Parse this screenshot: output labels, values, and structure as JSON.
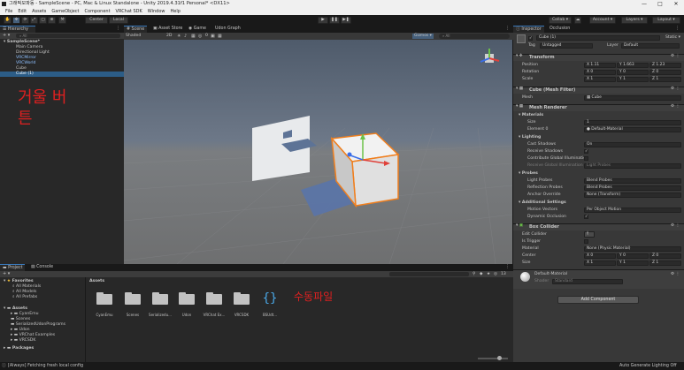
{
  "window": {
    "title": "그래픽모파동 - SampleScene - PC, Mac & Linux Standalone - Unity 2019.4.31f1 Personal* <DX11>",
    "controls": [
      "—",
      "□",
      "✕"
    ]
  },
  "menu": [
    "File",
    "Edit",
    "Assets",
    "GameObject",
    "Component",
    "VRChat SDK",
    "Window",
    "Help"
  ],
  "toolbar": {
    "pivot_label": "Center",
    "space_label": "Local",
    "play_icons": [
      "▶",
      "❚❚",
      "▶❚"
    ],
    "collab_label": "Collab ▾",
    "account_label": "Account ▾",
    "layers_label": "Layers ▾",
    "layout_label": "Layout ▾"
  },
  "hierarchy": {
    "tab": "Hierarchy",
    "search_placeholder": "All",
    "items": [
      {
        "label": "SampleScene*",
        "indent": 0,
        "color": "normal",
        "bold": true
      },
      {
        "label": "Main Camera",
        "indent": 1,
        "color": "normal"
      },
      {
        "label": "Directional Light",
        "indent": 1,
        "color": "normal"
      },
      {
        "label": "VRCMirror",
        "indent": 1,
        "color": "blue"
      },
      {
        "label": "VRCWorld",
        "indent": 1,
        "color": "blue"
      },
      {
        "label": "Cube",
        "indent": 1,
        "color": "normal"
      },
      {
        "label": "Cube (1)",
        "indent": 1,
        "color": "selected"
      }
    ],
    "annotation": "거울 버튼"
  },
  "scene_tabs": [
    "Scene",
    "Asset Store",
    "Game",
    "Udon Graph"
  ],
  "scene_toolbar": {
    "shading": "Shaded",
    "mode_2d": "2D",
    "gizmos": "Gizmos ▾",
    "search_placeholder": "All",
    "hidden_count": "0"
  },
  "project": {
    "tabs": [
      "Project",
      "Console"
    ],
    "favorites_title": "Favorites",
    "favorites": [
      "All Materials",
      "All Models",
      "All Prefabs"
    ],
    "assets_title": "Assets",
    "tree": [
      "CyanEmu",
      "Scenes",
      "SerializedUdonPrograms",
      "Udon",
      "VRChat Examples",
      "VRCSDK"
    ],
    "packages": "Packages",
    "breadcrumb": "Assets",
    "asset_items": [
      "CyanEmu",
      "Scenes",
      "Serializedu...",
      "Udon",
      "VRChat Ex...",
      "VRCSDK",
      "BSUdt..."
    ],
    "annotation": "수동파일",
    "hidden_count": "13"
  },
  "inspector": {
    "tabs": [
      "Inspector",
      "Occlusion"
    ],
    "object_name": "Cube (1)",
    "static_label": "Static ▾",
    "tag_label": "Tag",
    "tag_value": "Untagged",
    "layer_label": "Layer",
    "layer_value": "Default",
    "transform": {
      "title": "Transform",
      "rows": [
        {
          "label": "Position",
          "x": "1.11",
          "y": "1.663",
          "z": "1.23"
        },
        {
          "label": "Rotation",
          "x": "0",
          "y": "0",
          "z": "0"
        },
        {
          "label": "Scale",
          "x": "1",
          "y": "1",
          "z": "1"
        }
      ]
    },
    "mesh_filter": {
      "title": "Cube (Mesh Filter)",
      "mesh_label": "Mesh",
      "mesh_value": "Cube"
    },
    "mesh_renderer": {
      "title": "Mesh Renderer",
      "materials_label": "Materials",
      "size_label": "Size",
      "size_value": "1",
      "element_label": "Element 0",
      "element_value": "Default-Material",
      "lighting_label": "Lighting",
      "cast_shadows_label": "Cast Shadows",
      "cast_shadows_value": "On",
      "receive_shadows_label": "Receive Shadows",
      "contribute_gi_label": "Contribute Global Illuminatio",
      "receive_gi_label": "Receive Global Illumination",
      "receive_gi_value": "Light Probes",
      "probes_label": "Probes",
      "light_probes_label": "Light Probes",
      "light_probes_value": "Blend Probes",
      "reflection_probes_label": "Reflection Probes",
      "reflection_probes_value": "Blend Probes",
      "anchor_label": "Anchor Override",
      "anchor_value": "None (Transform)",
      "additional_label": "Additional Settings",
      "motion_vectors_label": "Motion Vectors",
      "motion_vectors_value": "Per Object Motion",
      "dynamic_occlusion_label": "Dynamic Occlusion"
    },
    "box_collider": {
      "title": "Box Collider",
      "edit_label": "Edit Collider",
      "trigger_label": "Is Trigger",
      "material_label": "Material",
      "material_value": "None (Physic Material)",
      "center_label": "Center",
      "center": {
        "x": "0",
        "y": "0",
        "z": "0"
      },
      "size_label": "Size",
      "size": {
        "x": "1",
        "y": "1",
        "z": "1"
      }
    },
    "material": {
      "name": "Default-Material",
      "shader_label": "Shader",
      "shader_value": "Standard"
    },
    "add_component": "Add Component"
  },
  "status": {
    "message": "[Always] Fetching fresh local config",
    "right": "Auto Generate Lighting Off"
  },
  "colors": {
    "accent": "#3a79bb",
    "selection": "#2c5d87",
    "annotation_red": "#e02020",
    "cube_outline": "#f07f1e"
  }
}
